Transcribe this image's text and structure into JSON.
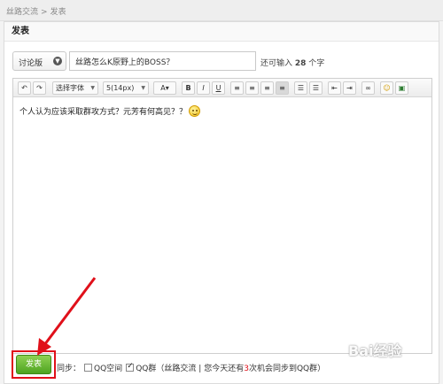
{
  "breadcrumb": {
    "root": "丝路交流",
    "separator": ">",
    "current": "发表"
  },
  "panel": {
    "title": "发表"
  },
  "form": {
    "forum_select": "讨论版",
    "title_value": "丝路怎么K原野上的BOSS？",
    "remaining_prefix": "还可输入",
    "remaining_count": "28",
    "remaining_suffix": "个字"
  },
  "toolbar": {
    "font_family": "选择字体",
    "font_size": "5(14px)",
    "undo_icon": "undo-icon",
    "redo_icon": "redo-icon",
    "bold": "B",
    "italic": "I",
    "underline": "U"
  },
  "editor": {
    "content": "个人认为应该采取群攻方式？元芳有何高见？？",
    "emoji": "smiley-icon"
  },
  "footer": {
    "publish_label": "发表",
    "sync_label": "同步：",
    "qq_space": "QQ空间",
    "qq_space_checked": false,
    "qq_group": "QQ群",
    "qq_group_checked": true,
    "note_open": "（",
    "note_group": "丝路交流",
    "note_sep": "|",
    "note_pre": "您今天还有",
    "note_count": "3",
    "note_post": "次机会同步到QQ群",
    "note_close": "）"
  },
  "colors": {
    "publish_button": "#5cb032",
    "highlight": "#e0101a"
  },
  "watermark": "Bai经验"
}
